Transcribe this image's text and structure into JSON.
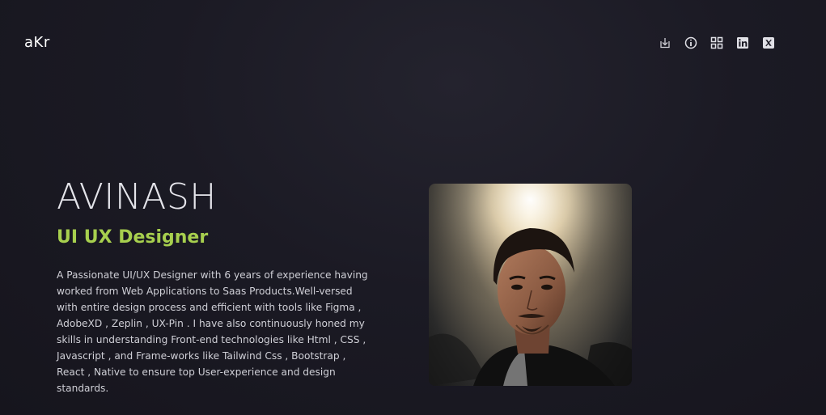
{
  "header": {
    "logo": "aKr",
    "icons": [
      "download-icon",
      "info-icon",
      "grid-icon",
      "linkedin-icon",
      "x-icon"
    ]
  },
  "hero": {
    "name": "AVINASH",
    "role": "UI UX Designer",
    "bio": "A Passionate UI/UX Designer with 6 years of experience having worked from Web Applications to Saas Products.Well-versed with entire design process and efficient with tools like Figma , AdobeXD , Zeplin , UX-Pin . I have also continuously honed my skills in understanding Front-end technologies like Html , CSS , Javascript , and Frame-works like Tailwind Css , Bootstrap , React , Native to ensure top User-experience and design standards."
  },
  "colors": {
    "background": "#1b1a24",
    "accent": "#a7cf4e",
    "text": "#cfcfd6"
  }
}
